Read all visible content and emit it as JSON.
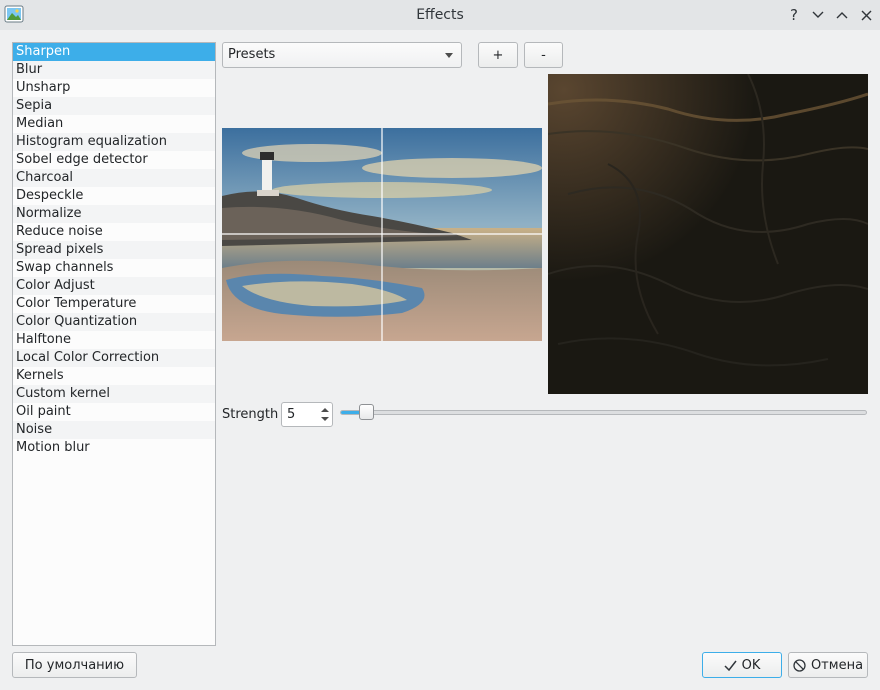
{
  "window": {
    "title": "Effects",
    "help_icon": "?"
  },
  "effects": {
    "selected_index": 0,
    "items": [
      "Sharpen",
      "Blur",
      "Unsharp",
      "Sepia",
      "Median",
      "Histogram equalization",
      "Sobel edge detector",
      "Charcoal",
      "Despeckle",
      "Normalize",
      "Reduce noise",
      "Spread pixels",
      "Swap channels",
      "Color Adjust",
      "Color Temperature",
      "Color Quantization",
      "Halftone",
      "Local Color Correction",
      "Kernels",
      "Custom kernel",
      "Oil paint",
      "Noise",
      "Motion blur"
    ]
  },
  "presets": {
    "selected": "Presets",
    "add_label": "+",
    "remove_label": "-"
  },
  "strength": {
    "label": "Strength",
    "value": "5",
    "slider_fraction": 0.05
  },
  "footer": {
    "defaults_label": "По умолчанию",
    "ok_label": "OK",
    "cancel_label": "Отмена"
  },
  "colors": {
    "accent": "#3daee9"
  },
  "icons": [
    "app-icon",
    "help-icon",
    "minimize-icon",
    "maximize-icon",
    "close-icon",
    "check-icon",
    "cancel-icon"
  ]
}
